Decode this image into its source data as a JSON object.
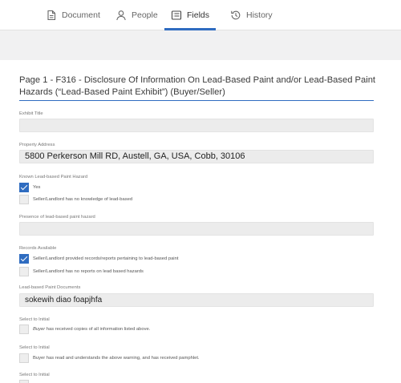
{
  "tabs": [
    {
      "label": "Document",
      "icon": "document-icon"
    },
    {
      "label": "People",
      "icon": "person-icon"
    },
    {
      "label": "Fields",
      "icon": "fields-icon"
    },
    {
      "label": "History",
      "icon": "history-icon"
    }
  ],
  "active_tab": "Fields",
  "accent_color": "#2f6cc0",
  "page_title": "Page 1 - F316 - Disclosure Of Information On Lead-Based Paint and/or Lead-Based Paint Hazards (“Lead-Based Paint Exhibit”) (Buyer/Seller)",
  "fields": {
    "exhibit_title": {
      "label": "Exhibit Title",
      "value": ""
    },
    "property_address": {
      "label": "Property Address",
      "value": "5800 Perkerson Mill RD, Austell, GA, USA, Cobb, 30106"
    },
    "known_hazard": {
      "label": "Known Lead-based Paint Hazard",
      "options": [
        {
          "label": "Yes",
          "checked": true
        },
        {
          "label": "Seller/Landlord has no knowledge of lead-based",
          "checked": false
        }
      ]
    },
    "presence_hazard": {
      "label": "Presence of lead-based paint hazard",
      "value": ""
    },
    "records_available": {
      "label": "Records Available",
      "options": [
        {
          "label": "Seller/Landlord provided records/reports pertaining to lead-based paint",
          "checked": true
        },
        {
          "label": "Seller/Landlord has no reports on lead based hazards",
          "checked": false
        }
      ]
    },
    "lead_documents": {
      "label": "Lead-based Paint Documents",
      "value": "sokewih diao foapjhfa"
    },
    "initial_1": {
      "label": "Select to Initial",
      "prefix": "Buyer",
      "text": " has received copies of all information listed above.",
      "checked": false
    },
    "initial_2": {
      "label": "Select to Initial",
      "text": "Buyer has read and understands the above warning, and has received pamphlet.",
      "checked": false
    },
    "initial_3": {
      "label": "Select to Initial"
    }
  }
}
